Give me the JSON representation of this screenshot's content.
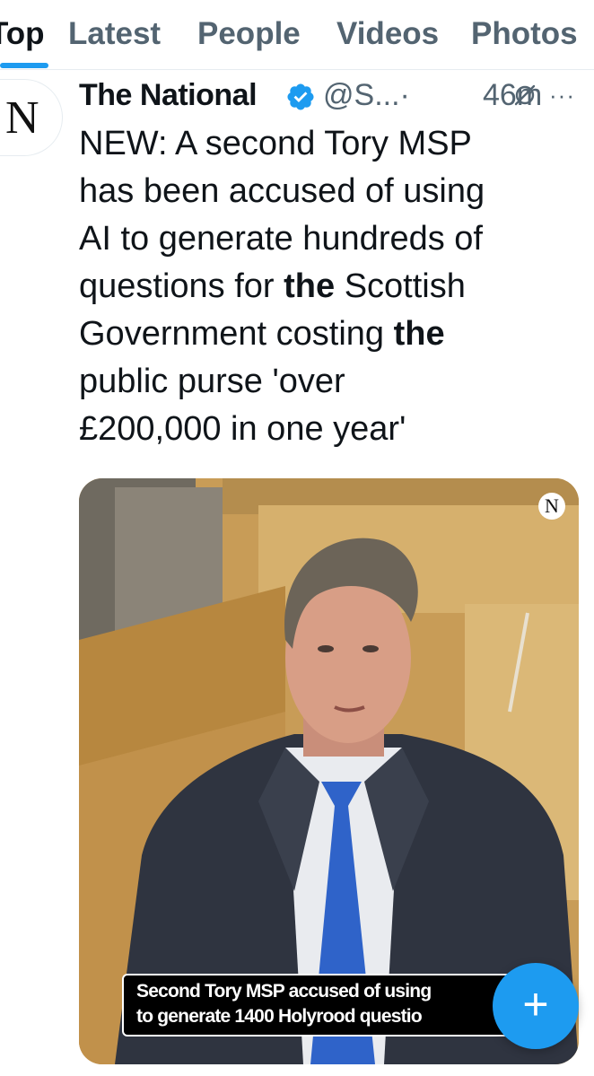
{
  "tabs": [
    {
      "label": "Top",
      "active": true
    },
    {
      "label": "Latest",
      "active": false
    },
    {
      "label": "People",
      "active": false
    },
    {
      "label": "Videos",
      "active": false
    },
    {
      "label": "Photos",
      "active": false
    }
  ],
  "tweet": {
    "avatar_letter": "N",
    "display_name": "The National",
    "verified_icon": "verified-badge-icon",
    "handle": "@S...",
    "time": "46m",
    "actions": [
      "grok-icon",
      "more-icon"
    ],
    "more_label": "···",
    "text": {
      "l1": "NEW: A second Tory MSP",
      "l2": "has been accused of using",
      "l3": "AI to generate hundreds of",
      "l4_pre": "questions for ",
      "l4_bold": "the",
      "l4_post": " Scottish",
      "l5_pre": "Government costing ",
      "l5_bold": "the",
      "l6": "public purse 'over",
      "l7": "£200,000 in one year'"
    },
    "media": {
      "badge": "N",
      "caption_line1": "Second Tory MSP accused of using",
      "caption_line2": "to generate 1400 Holyrood questio"
    }
  },
  "fab": {
    "label": "+",
    "icon": "compose-icon"
  },
  "colors": {
    "accent": "#1d9bf0",
    "secondary_text": "#536471",
    "primary_text": "#0f1419"
  }
}
